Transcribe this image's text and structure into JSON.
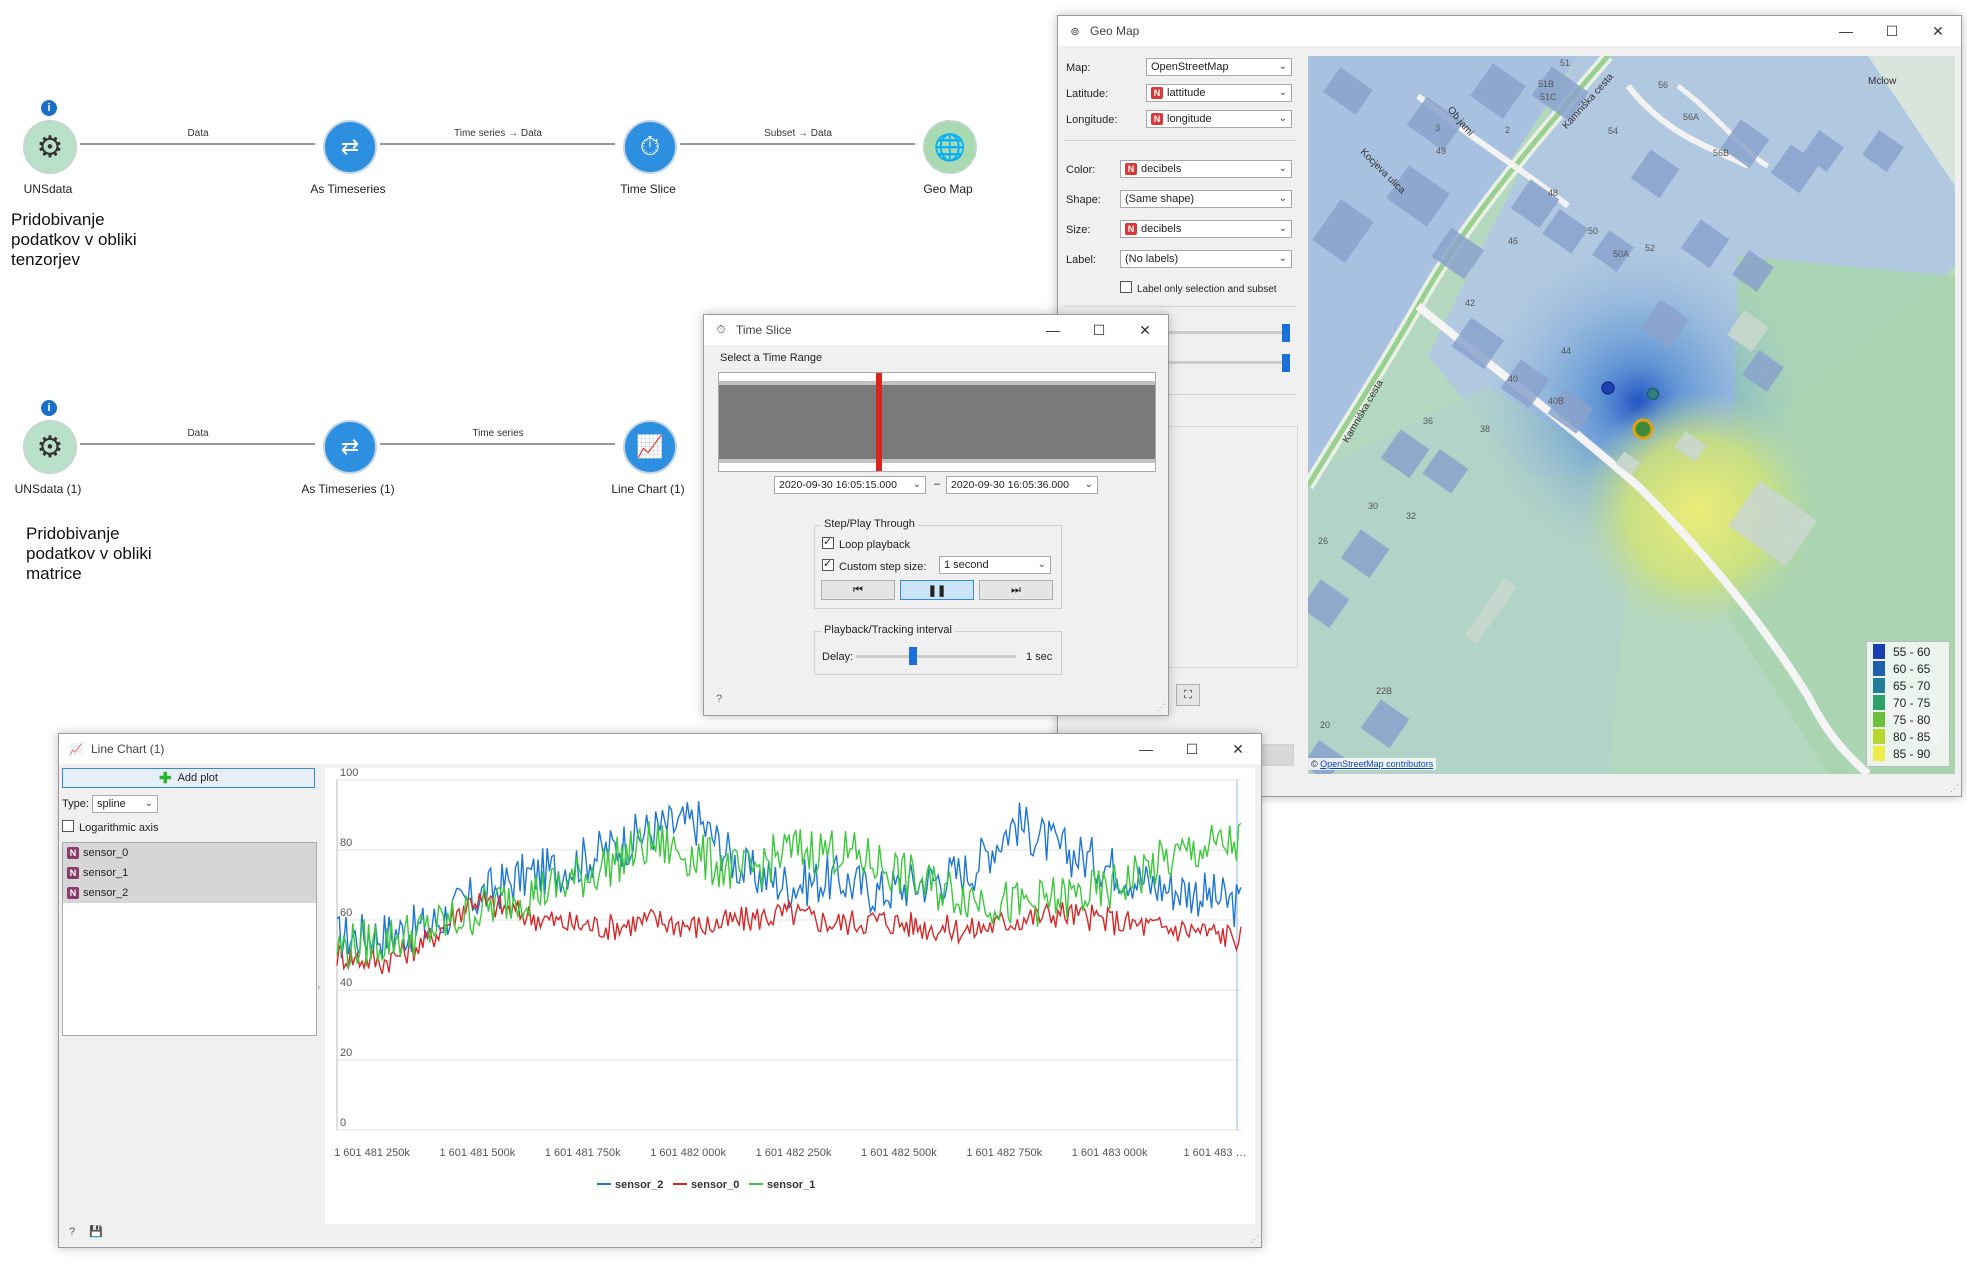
{
  "workflow": {
    "row1": {
      "nodes": [
        {
          "label": "UNSdata",
          "icon": "gear-icon"
        },
        {
          "label": "As Timeseries",
          "icon": "timeseries-icon"
        },
        {
          "label": "Time Slice",
          "icon": "stopwatch-icon"
        },
        {
          "label": "Geo Map",
          "icon": "globe-icon"
        }
      ],
      "links": [
        "Data",
        "Time series → Data",
        "Subset → Data"
      ],
      "note": "Pridobivanje podatkov v obliki tenzorjev"
    },
    "row2": {
      "nodes": [
        {
          "label": "UNSdata (1)",
          "icon": "gear-icon"
        },
        {
          "label": "As Timeseries (1)",
          "icon": "timeseries-icon"
        },
        {
          "label": "Line Chart (1)",
          "icon": "line-chart-icon"
        }
      ],
      "links": [
        "Data",
        "Time series"
      ],
      "note": "Pridobivanje podatkov v obliki matrice"
    }
  },
  "geomap": {
    "title": "Geo Map",
    "map_label": "Map:",
    "map_value": "OpenStreetMap",
    "latitude_label": "Latitude:",
    "latitude_value": "lattitude",
    "longitude_label": "Longitude:",
    "longitude_value": "longitude",
    "color_label": "Color:",
    "color_value": "decibels",
    "shape_label": "Shape:",
    "shape_value": "(Same shape)",
    "size_label": "Size:",
    "size_value": "decibels",
    "label_label": "Label:",
    "label_value": "(No labels)",
    "label_only": "Label only selection and subset",
    "attribution": "OpenStreetMap contributors",
    "streets": [
      "Kamniška cesta",
      "Kamniška cesta",
      "Ob jami",
      "Kocjeva ulica",
      "Mclow"
    ],
    "house_numbers": [
      "51",
      "51B",
      "51C",
      "56",
      "56A",
      "56B",
      "49",
      "3",
      "2",
      "54",
      "48",
      "46",
      "50",
      "50A",
      "52",
      "42",
      "44",
      "40",
      "40B",
      "36",
      "38",
      "30",
      "32",
      "26",
      "22B",
      "20"
    ],
    "legend": [
      {
        "label": "55 - 60",
        "color": "#1a3db5"
      },
      {
        "label": "60 - 65",
        "color": "#1f5fb0"
      },
      {
        "label": "65 - 70",
        "color": "#217f9a"
      },
      {
        "label": "70 - 75",
        "color": "#2ea06a"
      },
      {
        "label": "75 - 80",
        "color": "#6cbf3a"
      },
      {
        "label": "80 - 85",
        "color": "#b7d72e"
      },
      {
        "label": "85 - 90",
        "color": "#f2ec4a"
      }
    ]
  },
  "timeslice": {
    "title": "Time Slice",
    "range_group": "Select a Time Range",
    "from": "2020-09-30  16:05:15.000",
    "to": "2020-09-30  16:05:36.000",
    "dash": "–",
    "step_group": "Step/Play Through",
    "loop": "Loop playback",
    "custom_step": "Custom step size:",
    "step_value": "1 second",
    "interval_group": "Playback/Tracking interval",
    "delay_label": "Delay:",
    "delay_value": "1 sec"
  },
  "linechart": {
    "title": "Line Chart (1)",
    "add_plot": "Add plot",
    "type_label": "Type:",
    "type_value": "spline",
    "log_axis": "Logarithmic axis",
    "variables": [
      "sensor_0",
      "sensor_1",
      "sensor_2"
    ]
  },
  "chart_data": {
    "type": "line",
    "ylim": [
      0,
      100
    ],
    "yticks": [
      0,
      20,
      40,
      60,
      80,
      100
    ],
    "xtick_labels": [
      "1 601 481 250k",
      "1 601 481 500k",
      "1 601 481 750k",
      "1 601 482 000k",
      "1 601 482 250k",
      "1 601 482 500k",
      "1 601 482 750k",
      "1 601 483 000k",
      "1 601 483 …"
    ],
    "x": [
      0,
      5,
      10,
      15,
      20,
      25,
      30,
      35,
      40,
      45,
      50,
      55,
      60,
      65,
      70,
      75,
      80,
      85,
      90,
      95,
      100
    ],
    "series": [
      {
        "name": "sensor_2",
        "color": "#1f77d4",
        "values": [
          55,
          56,
          58,
          66,
          72,
          75,
          80,
          86,
          88,
          74,
          70,
          72,
          68,
          71,
          74,
          88,
          80,
          76,
          70,
          68,
          64
        ]
      },
      {
        "name": "sensor_0",
        "color": "#d62828",
        "values": [
          50,
          48,
          54,
          66,
          62,
          59,
          58,
          60,
          58,
          60,
          62,
          59,
          60,
          58,
          57,
          60,
          62,
          60,
          58,
          57,
          55
        ]
      },
      {
        "name": "sensor_1",
        "color": "#3cc83c",
        "values": [
          52,
          54,
          57,
          62,
          67,
          70,
          76,
          82,
          78,
          73,
          80,
          80,
          76,
          70,
          67,
          64,
          66,
          68,
          75,
          80,
          82
        ]
      }
    ]
  }
}
